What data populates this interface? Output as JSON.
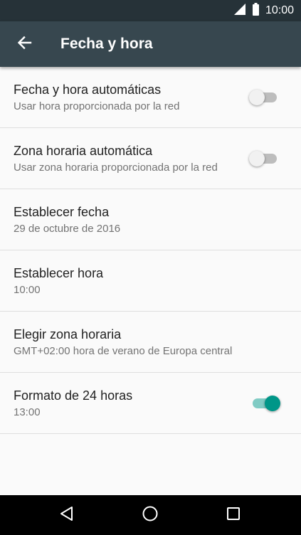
{
  "status_bar": {
    "time": "10:00",
    "icons": [
      "signal-icon",
      "battery-icon"
    ]
  },
  "header": {
    "title": "Fecha y hora",
    "back_icon": "arrow-back-icon"
  },
  "settings": [
    {
      "title": "Fecha y hora automáticas",
      "summary": "Usar hora proporcionada por la red",
      "toggle": "off"
    },
    {
      "title": "Zona horaria automática",
      "summary": "Usar zona horaria proporcionada por la red",
      "toggle": "off"
    },
    {
      "title": "Establecer fecha",
      "summary": "29 de octubre de 2016"
    },
    {
      "title": "Establecer hora",
      "summary": "10:00"
    },
    {
      "title": "Elegir zona horaria",
      "summary": "GMT+02:00 hora de verano de Europa central"
    },
    {
      "title": "Formato de 24 horas",
      "summary": "13:00",
      "toggle": "on"
    }
  ],
  "nav_bar": {
    "buttons": [
      "back-triangle-icon",
      "home-circle-icon",
      "recents-square-icon"
    ]
  },
  "colors": {
    "status_bar": "#263238",
    "app_bar": "#37474f",
    "accent": "#009688",
    "background": "#fafafa"
  }
}
